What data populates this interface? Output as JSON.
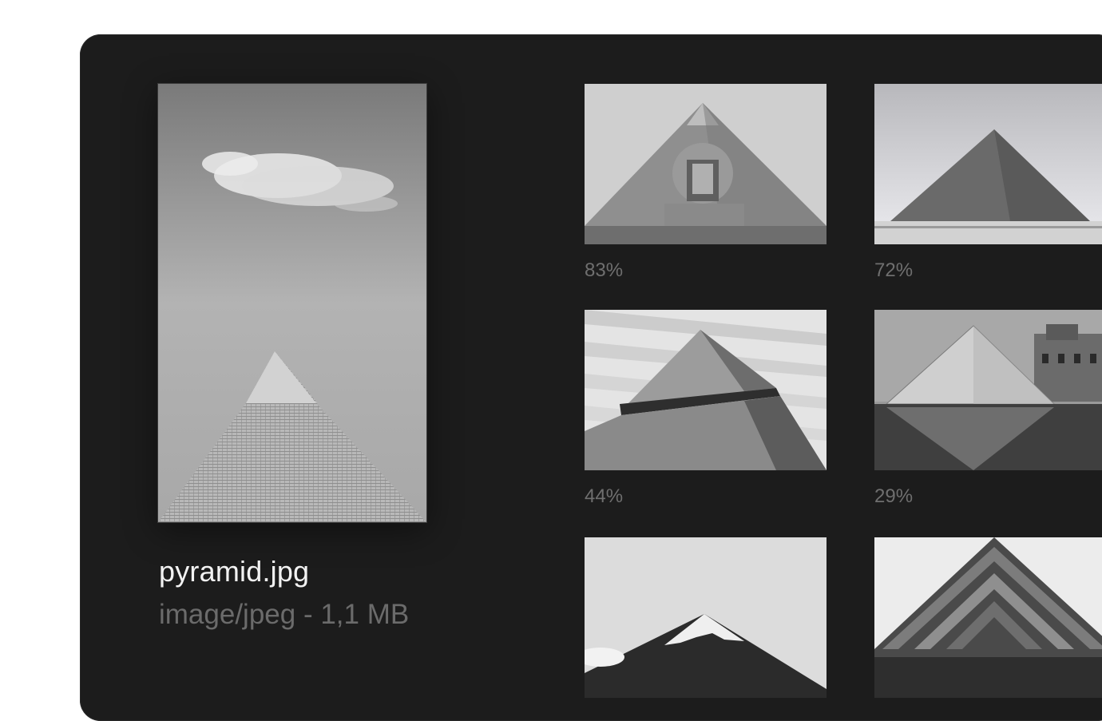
{
  "selected_file": {
    "name": "pyramid.jpg",
    "meta": "image/jpeg - 1,1 MB",
    "preview_icon": "pyramid-photo"
  },
  "results": [
    {
      "score": "83%",
      "subject": "sphinx-and-pyramid"
    },
    {
      "score": "72%",
      "subject": "great-pyramid"
    },
    {
      "score": "44%",
      "subject": "abstract-pyramid"
    },
    {
      "score": "29%",
      "subject": "louvre-pyramid"
    },
    {
      "score": "",
      "subject": "mountain-peak"
    },
    {
      "score": "",
      "subject": "pyramid-building"
    }
  ],
  "colors": {
    "panel": "#1c1c1c",
    "filename": "#f2f2f2",
    "muted": "#6b6b6b"
  }
}
